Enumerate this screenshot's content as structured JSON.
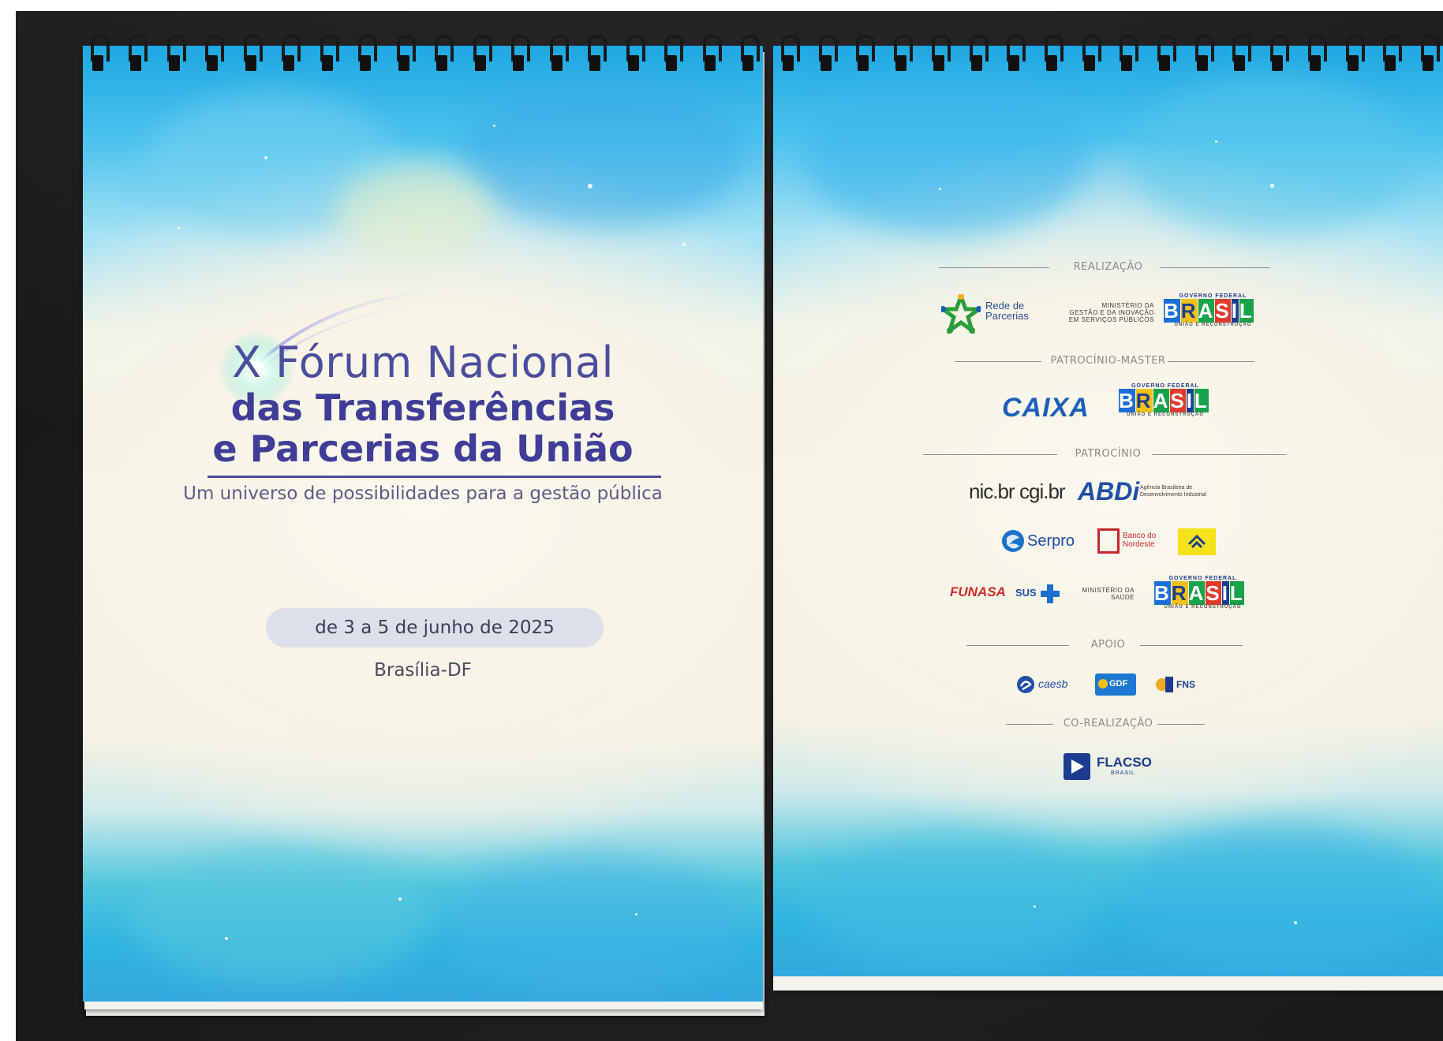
{
  "left_cover": {
    "title_line1": "X Fórum Nacional",
    "title_line2": "das Transferências",
    "title_line3": "e Parcerias da União",
    "subtitle": "Um universo de possibilidades para a gestão pública",
    "dates": "de 3 a 5 de junho de 2025",
    "place": "Brasília-DF"
  },
  "right_cover": {
    "sections": {
      "realizacao": "REALIZAÇÃO",
      "patrocinio_master": "PATROCÍNIO-MASTER",
      "patrocinio": "PATROCÍNIO",
      "apoio": "APOIO",
      "co_realizacao": "CO-REALIZAÇÃO"
    },
    "logos": {
      "rede_parcerias_1": "Rede de",
      "rede_parcerias_2": "Parcerias",
      "mgi_1": "MINISTÉRIO DA",
      "mgi_2": "GESTÃO E DA INOVAÇÃO",
      "mgi_3": "EM SERVIÇOS PÚBLICOS",
      "governo_federal": "GOVERNO FEDERAL",
      "brasil": "BRASIL",
      "uniao_reconstrucao": "UNIÃO E RECONSTRUÇÃO",
      "caixa": "CAIXA",
      "nic_br": "nic.br",
      "cgi_br": "cgi.br",
      "abdi": "ABDi",
      "abdi_sub_1": "Agência Brasileira de",
      "abdi_sub_2": "Desenvolvimento Industrial",
      "serpro": "Serpro",
      "bnb_1": "Banco do",
      "bnb_2": "Nordeste",
      "funasa": "FUNASA",
      "sus": "SUS",
      "saude_1": "MINISTÉRIO DA",
      "saude_2": "SAÚDE",
      "caesb": "caesb",
      "gdf": "GDF",
      "fns": "FNS",
      "flacso": "FLACSO",
      "flacso_sub": "BRASIL"
    }
  }
}
